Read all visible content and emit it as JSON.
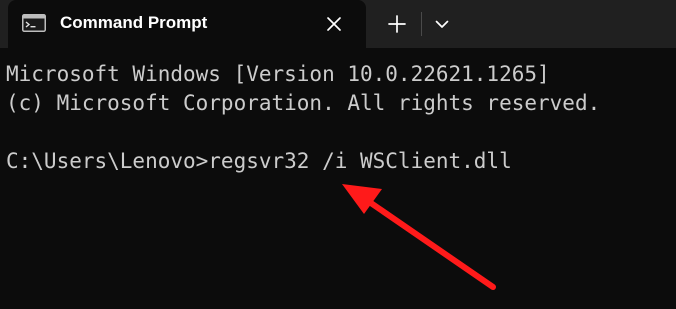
{
  "window": {
    "tab_title": "Command Prompt",
    "new_tab_label": "+",
    "icons": {
      "tab": "terminal-icon",
      "close": "close-icon",
      "new_tab": "plus-icon",
      "dropdown": "chevron-down-icon",
      "annotation": "red-arrow-icon"
    }
  },
  "console": {
    "lines": [
      "Microsoft Windows [Version 10.0.22621.1265]",
      "(c) Microsoft Corporation. All rights reserved.",
      "",
      "C:\\Users\\Lenovo>regsvr32 /i WSClient.dll"
    ]
  },
  "colors": {
    "titlebar": "#202020",
    "background": "#0c0c0c",
    "text": "#cccccc",
    "arrow": "#ff1a1a"
  }
}
